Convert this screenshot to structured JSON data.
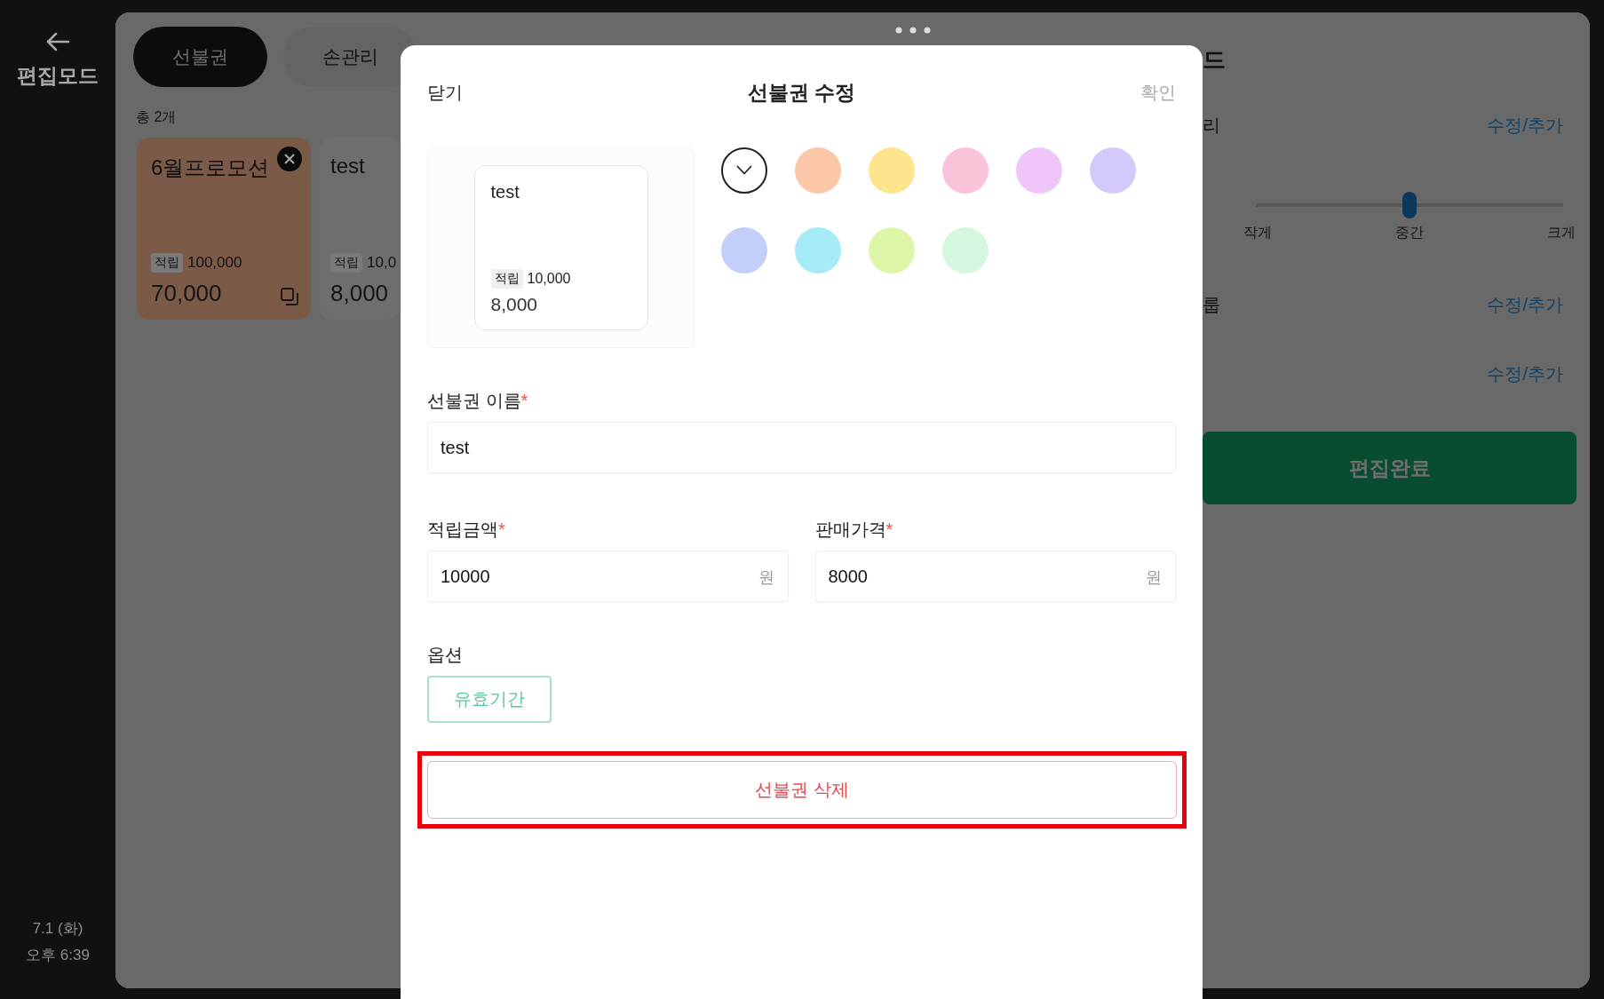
{
  "sidebar": {
    "title": "편집모드",
    "date": "7.1 (화)",
    "time": "오후 6:39"
  },
  "tabs": [
    {
      "label": "선불권",
      "selected": true
    },
    {
      "label": "손관리",
      "selected": false
    }
  ],
  "count": "총 2개",
  "cards": [
    {
      "name": "6월프로모션",
      "accrual_label": "적립",
      "accrual": "100,000",
      "price": "70,000",
      "color": "#7b5a48",
      "editable": true
    },
    {
      "name": "test",
      "accrual_label": "적립",
      "accrual": "10,0",
      "price": "8,000",
      "color": "#6e6e6e",
      "editable": false
    }
  ],
  "settings": {
    "title_fragment": "드",
    "rows": [
      {
        "kind": "link",
        "label": "리",
        "action": "수정/추가"
      },
      {
        "kind": "slider",
        "level": 0.5,
        "labels": [
          "작게",
          "중간",
          "크게"
        ]
      },
      {
        "kind": "link",
        "label": "룹",
        "action": "수정/추가"
      },
      {
        "kind": "link",
        "action": "수정/추가"
      }
    ],
    "done_button": "편집완료"
  },
  "modal": {
    "close": "닫기",
    "title": "선불권 수정",
    "confirm": "확인",
    "confirm_enabled": false,
    "preview": {
      "name": "test",
      "accrual_label": "적립",
      "accrual": "10,000",
      "price": "8,000"
    },
    "colors": [
      {
        "color": "#ffffff",
        "selected": true
      },
      {
        "color": "#fcc7a6",
        "selected": false
      },
      {
        "color": "#fde58e",
        "selected": false
      },
      {
        "color": "#fbc3da",
        "selected": false
      },
      {
        "color": "#eec6fa",
        "selected": false
      },
      {
        "color": "#d5c9fb",
        "selected": false
      },
      {
        "color": "#c3cffb",
        "selected": false
      },
      {
        "color": "#a6ecf6",
        "selected": false
      },
      {
        "color": "#ddf5a7",
        "selected": false
      },
      {
        "color": "#d5f6df",
        "selected": false
      }
    ],
    "name_field": {
      "label": "선불권 이름",
      "required_mark": "*",
      "value": "test"
    },
    "amount_fields": [
      {
        "label": "적립금액",
        "required_mark": "*",
        "value": "10000",
        "unit": "원"
      },
      {
        "label": "판매가격",
        "required_mark": "*",
        "value": "8000",
        "unit": "원"
      }
    ],
    "options_label": "옵션",
    "options": [
      {
        "label": "유효기간",
        "selected": false
      }
    ],
    "delete_button": "선불권 삭제",
    "delete_highlighted": true
  }
}
